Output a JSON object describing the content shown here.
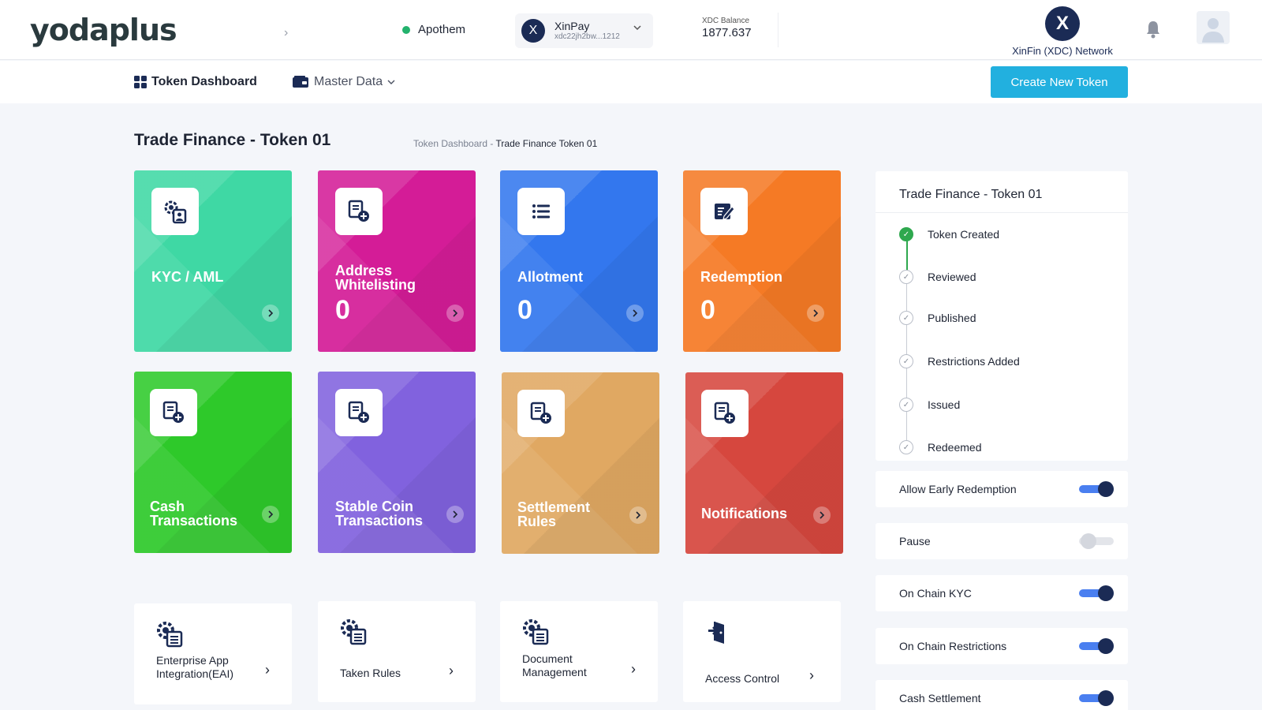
{
  "header": {
    "logo_text": "yodaplus",
    "network_status": "Apothem",
    "wallet": {
      "name": "XinPay",
      "address": "xdc22jh2bw...1212",
      "avatar_letter": "X"
    },
    "balance": {
      "label": "XDC Balance",
      "value": "1877.637"
    },
    "network": {
      "avatar_letter": "X",
      "label": "XinFin (XDC) Network"
    }
  },
  "nav": {
    "tabs": [
      {
        "label": "Token Dashboard",
        "active": true
      },
      {
        "label": "Master Data",
        "active": false
      }
    ],
    "create_button": "Create New Token"
  },
  "page": {
    "title": "Trade Finance - Token 01",
    "breadcrumb": {
      "parent": "Token Dashboard",
      "separator": "-",
      "current": "Trade Finance Token 01"
    }
  },
  "tiles": [
    {
      "label": "KYC / AML",
      "count": "",
      "color": "#3fd8a4"
    },
    {
      "label": "Address Whitelisting",
      "count": "0",
      "color": "#d41c97"
    },
    {
      "label": "Allotment",
      "count": "0",
      "color": "#3377ee"
    },
    {
      "label": "Redemption",
      "count": "0",
      "color": "#f57a25"
    },
    {
      "label": "Cash Transactions",
      "count": "",
      "color": "#2ec92a"
    },
    {
      "label": "Stable Coin Transactions",
      "count": "",
      "color": "#8162de"
    },
    {
      "label": "Settlement Rules",
      "count": "",
      "color": "#e0a862"
    },
    {
      "label": "Notifications",
      "count": "",
      "color": "#d6473e"
    }
  ],
  "cards": [
    {
      "label": "Enterprise App Integration(EAI)"
    },
    {
      "label": "Taken Rules"
    },
    {
      "label": "Document Management"
    },
    {
      "label": "Access Control"
    }
  ],
  "status": {
    "title": "Trade Finance - Token 01",
    "steps": [
      {
        "label": "Token Created",
        "done": true
      },
      {
        "label": "Reviewed",
        "done": false
      },
      {
        "label": "Published",
        "done": false
      },
      {
        "label": "Restrictions Added",
        "done": false
      },
      {
        "label": "Issued",
        "done": false
      },
      {
        "label": "Redeemed",
        "done": false
      }
    ]
  },
  "toggles": [
    {
      "label": "Allow Early Redemption",
      "on": true
    },
    {
      "label": "Pause",
      "on": false
    },
    {
      "label": "On Chain KYC",
      "on": true
    },
    {
      "label": "On Chain Restrictions",
      "on": true
    },
    {
      "label": "Cash Settlement",
      "on": true
    }
  ],
  "icons": {
    "bell": "bell-icon",
    "user": "user-avatar-icon",
    "dashboard": "dashboard-icon",
    "master_data": "wallet-card-icon"
  }
}
